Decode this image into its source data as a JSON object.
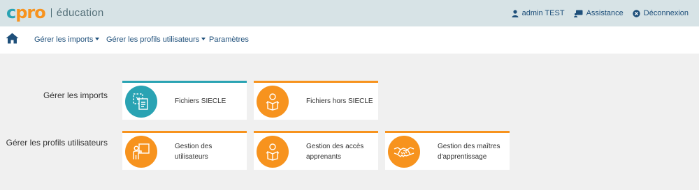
{
  "logo": {
    "text": "cpro",
    "subtitle": "éducation"
  },
  "top_links": [
    {
      "label": "admin TEST",
      "icon": "user-icon"
    },
    {
      "label": "Assistance",
      "icon": "assistance-icon"
    },
    {
      "label": "Déconnexion",
      "icon": "close-circle-icon"
    }
  ],
  "nav": {
    "home_icon": "home-icon",
    "items": [
      {
        "label": "Gérer les imports",
        "dropdown": true
      },
      {
        "label": "Gérer les profils utilisateurs",
        "dropdown": true
      },
      {
        "label": "Paramètres",
        "dropdown": false
      }
    ]
  },
  "sections": [
    {
      "label": "Gérer les imports",
      "cards": [
        {
          "label": "Fichiers SIECLE",
          "icon": "document-import-icon",
          "color": "#2aa3b3"
        },
        {
          "label": "Fichiers hors SIECLE",
          "icon": "user-book-icon",
          "color": "#f7931e"
        }
      ]
    },
    {
      "label": "Gérer les profils utilisateurs",
      "cards": [
        {
          "label": "Gestion des utilisateurs",
          "icon": "user-board-icon",
          "color": "#f7931e"
        },
        {
          "label": "Gestion des accès apprenants",
          "icon": "user-book-icon",
          "color": "#f7931e"
        },
        {
          "label": "Gestion des maîtres d'apprentissage",
          "icon": "handshake-icon",
          "color": "#f7931e"
        }
      ]
    }
  ],
  "colors": {
    "accent_orange": "#f7931e",
    "accent_teal": "#2aa3b3",
    "link_blue": "#1e4f7a",
    "header_bg": "#d7e3e6"
  }
}
